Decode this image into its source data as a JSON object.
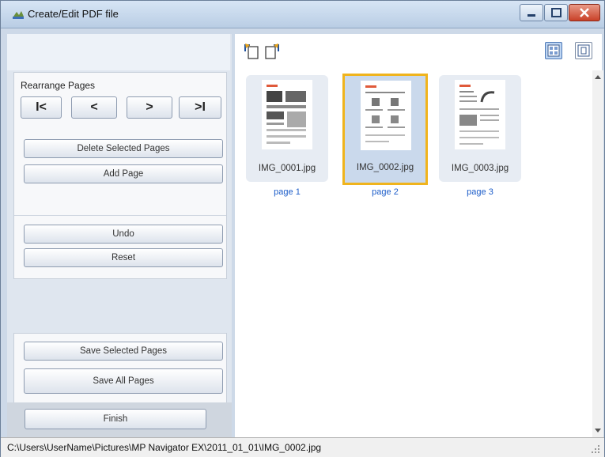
{
  "window": {
    "title": "Create/Edit PDF file"
  },
  "rearrange": {
    "label": "Rearrange Pages",
    "first_icon": "first-page-icon",
    "prev_icon": "previous-page-icon",
    "next_icon": "next-page-icon",
    "last_icon": "last-page-icon",
    "first_glyph": "I<",
    "prev_glyph": "<",
    "next_glyph": ">",
    "last_glyph": ">I"
  },
  "actions": {
    "delete_label": "Delete Selected Pages",
    "add_label": "Add Page",
    "undo_label": "Undo",
    "reset_label": "Reset"
  },
  "save": {
    "selected_label": "Save Selected Pages",
    "all_label": "Save All Pages"
  },
  "finish_label": "Finish",
  "pages": [
    {
      "file": "IMG_0001.jpg",
      "label": "page 1",
      "selected": false
    },
    {
      "file": "IMG_0002.jpg",
      "label": "page 2",
      "selected": true
    },
    {
      "file": "IMG_0003.jpg",
      "label": "page 3",
      "selected": false
    }
  ],
  "status": {
    "path": "C:\\Users\\UserName\\Pictures\\MP Navigator EX\\2011_01_01\\IMG_0002.jpg"
  },
  "colors": {
    "selection_border": "#f0b41d",
    "page_label": "#1c5dc9",
    "title_bar": "#c7d9ee",
    "close_button": "#c94128"
  }
}
